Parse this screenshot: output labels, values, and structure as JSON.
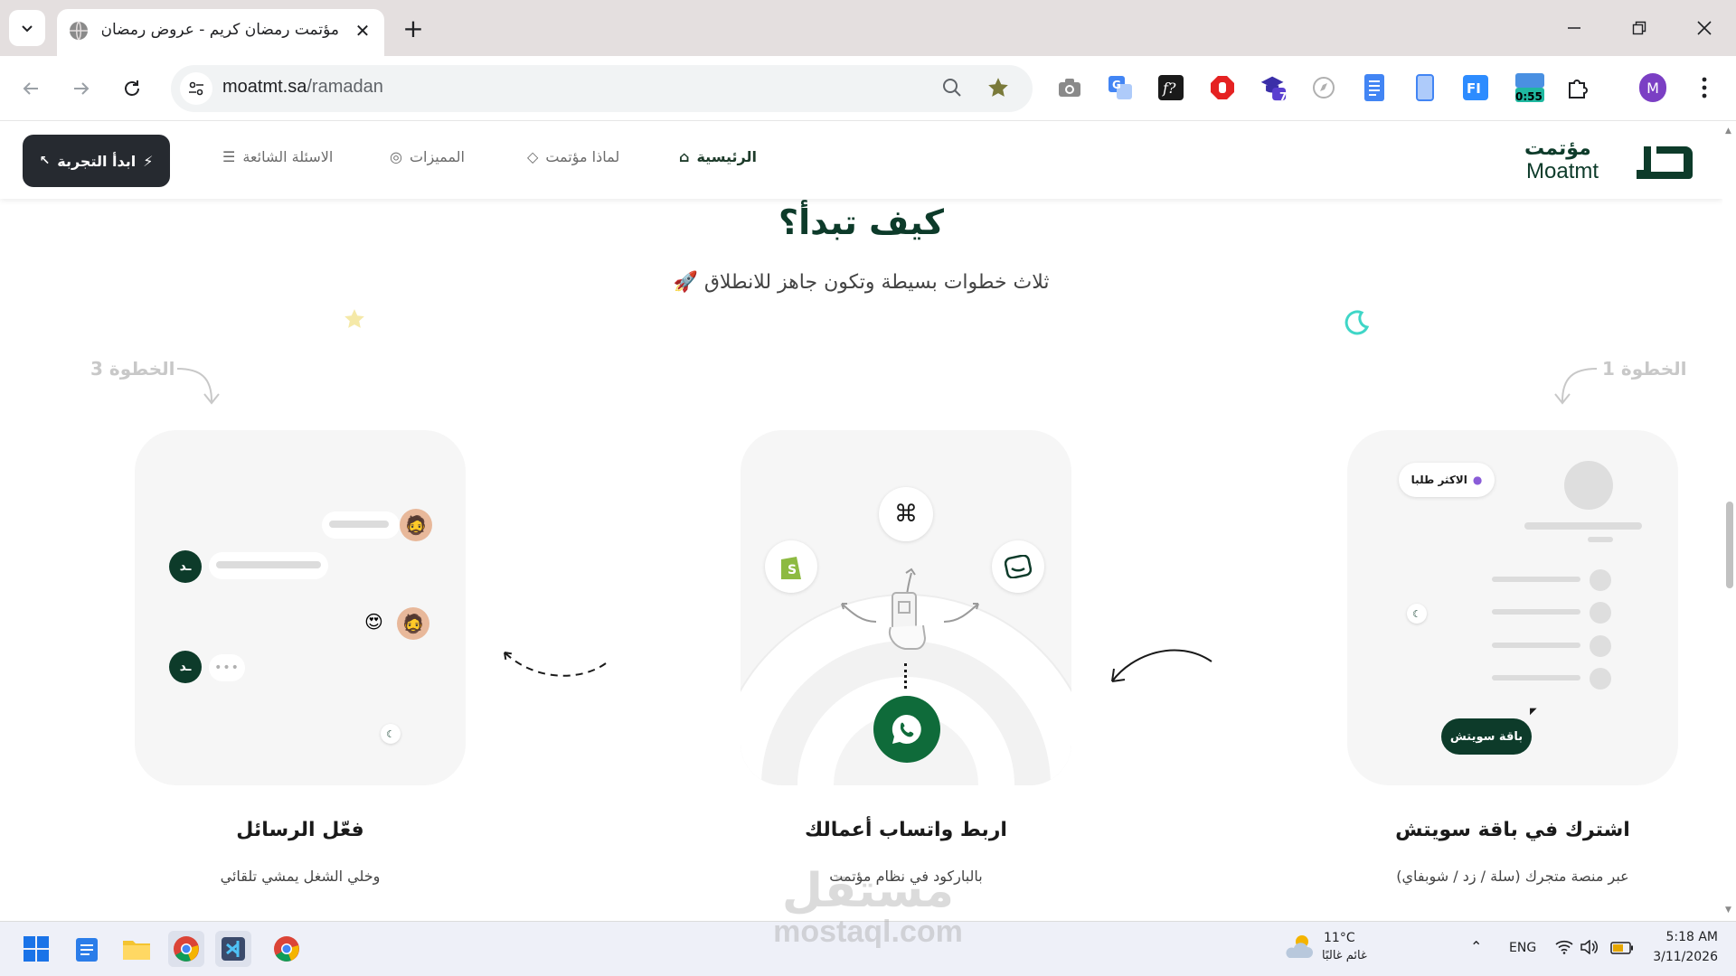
{
  "browser": {
    "tab_title": "مؤتمت رمضان كريم - عروض رمضان",
    "url_host": "moatmt.sa",
    "url_path": "/ramadan",
    "timer_badge": "0:55",
    "ext_badge_count": "7",
    "profile_initial": "M"
  },
  "site": {
    "logo_ar": "مؤتمت",
    "logo_en": "Moatmt",
    "cta": "ابدأ التجربة",
    "nav": {
      "home": "الرئيسية",
      "why": "لماذا مؤتمت",
      "features": "المميزات",
      "faq": "الاسئلة الشائعة"
    }
  },
  "section": {
    "title": "كيف تبدأ؟",
    "subtitle": "ثلاث خطوات بسيطة وتكون جاهز للانطلاق 🚀",
    "steps": [
      {
        "label": "الخطوة 1",
        "title": "اشترك في باقة سويتش",
        "desc": "عبر منصة متجرك (سلة / زد / شوبفاي)"
      },
      {
        "label": "",
        "title": "اربط واتساب أعمالك",
        "desc": "بالباركود في نظام مؤتمت"
      },
      {
        "label": "الخطوة 3",
        "title": "فعّل الرسائل",
        "desc": "وخلي الشغل يمشي تلقائي"
      }
    ],
    "card1": {
      "badge": "الاكثر طلبا",
      "plan_button": "باقة سويتش"
    }
  },
  "taskbar": {
    "weather_temp": "11°C",
    "weather_desc": "غائم غالبًا",
    "lang": "ENG",
    "time": "5:18 AM",
    "date": "3/11/2026"
  },
  "watermark": {
    "ar": "مستقل",
    "en": "mostaql.com"
  },
  "colors": {
    "brand": "#0d3b2a",
    "whatsapp": "#0f6b3a",
    "accent_moon": "#3fd6c7"
  }
}
